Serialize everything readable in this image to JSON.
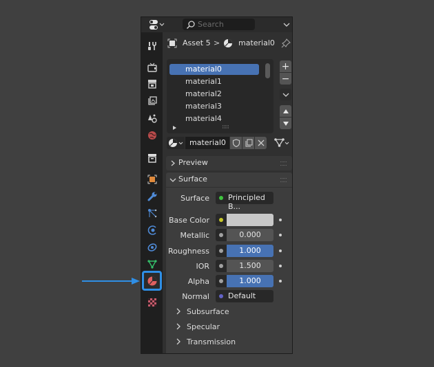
{
  "header": {
    "editor_type_icon": "properties-editor-icon",
    "search_placeholder": "Search",
    "options_icon": "chevron-down-icon"
  },
  "breadcrumb": {
    "object": "Asset 5",
    "separator": ">",
    "material": "material0",
    "pin_icon": "pin-icon"
  },
  "tabs": [
    {
      "name": "tool",
      "icon": "tool-icon"
    },
    {
      "name": "render",
      "icon": "render-icon"
    },
    {
      "name": "output",
      "icon": "output-icon"
    },
    {
      "name": "view-layer",
      "icon": "view-layer-icon"
    },
    {
      "name": "scene",
      "icon": "scene-icon"
    },
    {
      "name": "world",
      "icon": "world-icon"
    },
    {
      "name": "collection",
      "icon": "collection-icon"
    },
    {
      "name": "object",
      "icon": "object-icon"
    },
    {
      "name": "modifiers",
      "icon": "wrench-icon"
    },
    {
      "name": "particles",
      "icon": "particles-icon"
    },
    {
      "name": "physics",
      "icon": "physics-icon"
    },
    {
      "name": "constraints",
      "icon": "constraints-icon"
    },
    {
      "name": "data",
      "icon": "mesh-data-icon"
    },
    {
      "name": "material",
      "icon": "material-icon",
      "active": true
    },
    {
      "name": "texture",
      "icon": "texture-icon"
    }
  ],
  "material_slots": {
    "items": [
      "material0",
      "material1",
      "material2",
      "material3",
      "material4"
    ],
    "selected": "material0",
    "add_label": "+",
    "remove_label": "−"
  },
  "material_selector": {
    "name": "material0"
  },
  "panels": {
    "preview": "Preview",
    "surface": "Surface"
  },
  "surface": {
    "shader_label": "Surface",
    "shader_value": "Principled B...",
    "properties": [
      {
        "label": "Base Color",
        "value": "",
        "socket_color": "#c7c729",
        "kind": "color",
        "swatch": "#c8c8c8"
      },
      {
        "label": "Metallic",
        "value": "0.000",
        "socket_color": "#a1a1a1",
        "kind": "number",
        "fill": 0.0
      },
      {
        "label": "Roughness",
        "value": "1.000",
        "socket_color": "#a1a1a1",
        "kind": "number",
        "fill": 1.0
      },
      {
        "label": "IOR",
        "value": "1.500",
        "socket_color": "#a1a1a1",
        "kind": "number",
        "fill": 0.0
      },
      {
        "label": "Alpha",
        "value": "1.000",
        "socket_color": "#a1a1a1",
        "kind": "number",
        "fill": 1.0
      }
    ],
    "normal_label": "Normal",
    "normal_value": "Default",
    "subsections": [
      "Subsurface",
      "Specular",
      "Transmission"
    ]
  },
  "colors": {
    "accent": "#4772b3",
    "annotation_arrow": "#2f8fe6",
    "shader_socket": "#3fc43f",
    "normal_socket": "#6363c7"
  }
}
